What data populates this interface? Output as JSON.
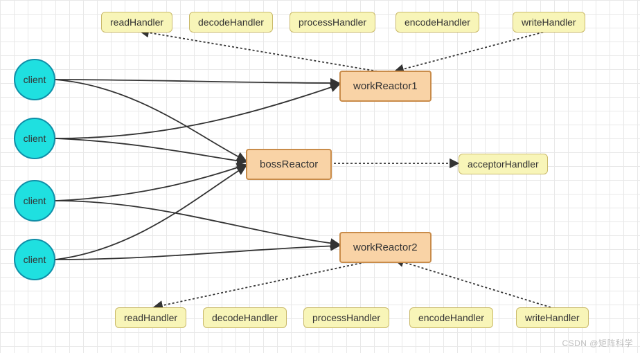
{
  "clients": [
    {
      "label": "client"
    },
    {
      "label": "client"
    },
    {
      "label": "client"
    },
    {
      "label": "client"
    }
  ],
  "handlers_top": {
    "read": "readHandler",
    "decode": "decodeHandler",
    "process": "processHandler",
    "encode": "encodeHandler",
    "write": "writeHandler"
  },
  "handlers_bottom": {
    "read": "readHandler",
    "decode": "decodeHandler",
    "process": "processHandler",
    "encode": "encodeHandler",
    "write": "writeHandler"
  },
  "reactors": {
    "work1": "workReactor1",
    "boss": "bossReactor",
    "work2": "workReactor2"
  },
  "acceptor": {
    "label": "acceptorHandler"
  },
  "watermark": "CSDN @矩阵科学"
}
